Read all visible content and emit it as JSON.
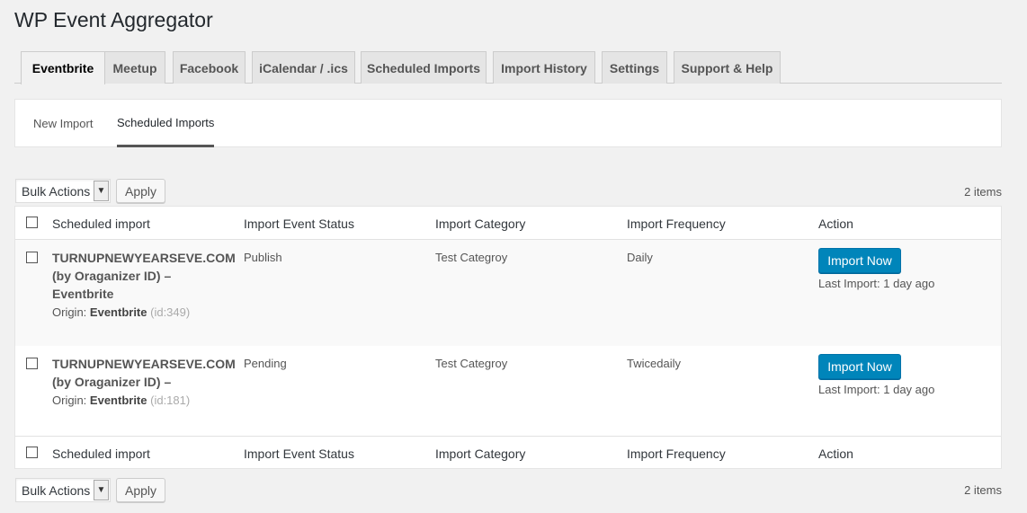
{
  "page": {
    "title": "WP Event Aggregator"
  },
  "tabs": [
    "Eventbrite",
    "Meetup",
    "Facebook",
    "iCalendar / .ics",
    "Scheduled Imports",
    "Import History",
    "Settings",
    "Support & Help"
  ],
  "subtabs": [
    "New Import",
    "Scheduled Imports"
  ],
  "bulk": {
    "select_value": "Bulk Actions",
    "apply_label": "Apply",
    "count": "2 items"
  },
  "columns": [
    "Scheduled import",
    "Import Event Status",
    "Import Category",
    "Import Frequency",
    "Action"
  ],
  "rows": [
    {
      "title_line1": "TURNUPNEWYEARSEVE.COM",
      "title_line2": "(by Oraganizer ID) –",
      "title_line3": "Eventbrite",
      "origin_label": "Origin:",
      "origin_value": "Eventbrite",
      "origin_id": "(id:349)",
      "status": "Publish",
      "category": "Test Categroy",
      "frequency": "Daily",
      "button": "Import Now",
      "last_import": "Last Import: 1 day ago"
    },
    {
      "title_line1": "TURNUPNEWYEARSEVE.COM",
      "title_line2": "(by Oraganizer ID) –",
      "title_line3": "",
      "origin_label": "Origin:",
      "origin_value": "Eventbrite",
      "origin_id": "(id:181)",
      "status": "Pending",
      "category": "Test Categroy",
      "frequency": "Twicedaily",
      "button": "Import Now",
      "last_import": "Last Import: 1 day ago"
    }
  ],
  "colors": {
    "primary": "#0085ba",
    "background": "#f1f1f1"
  },
  "icons": {
    "dropdown": "chevron-down-icon"
  }
}
